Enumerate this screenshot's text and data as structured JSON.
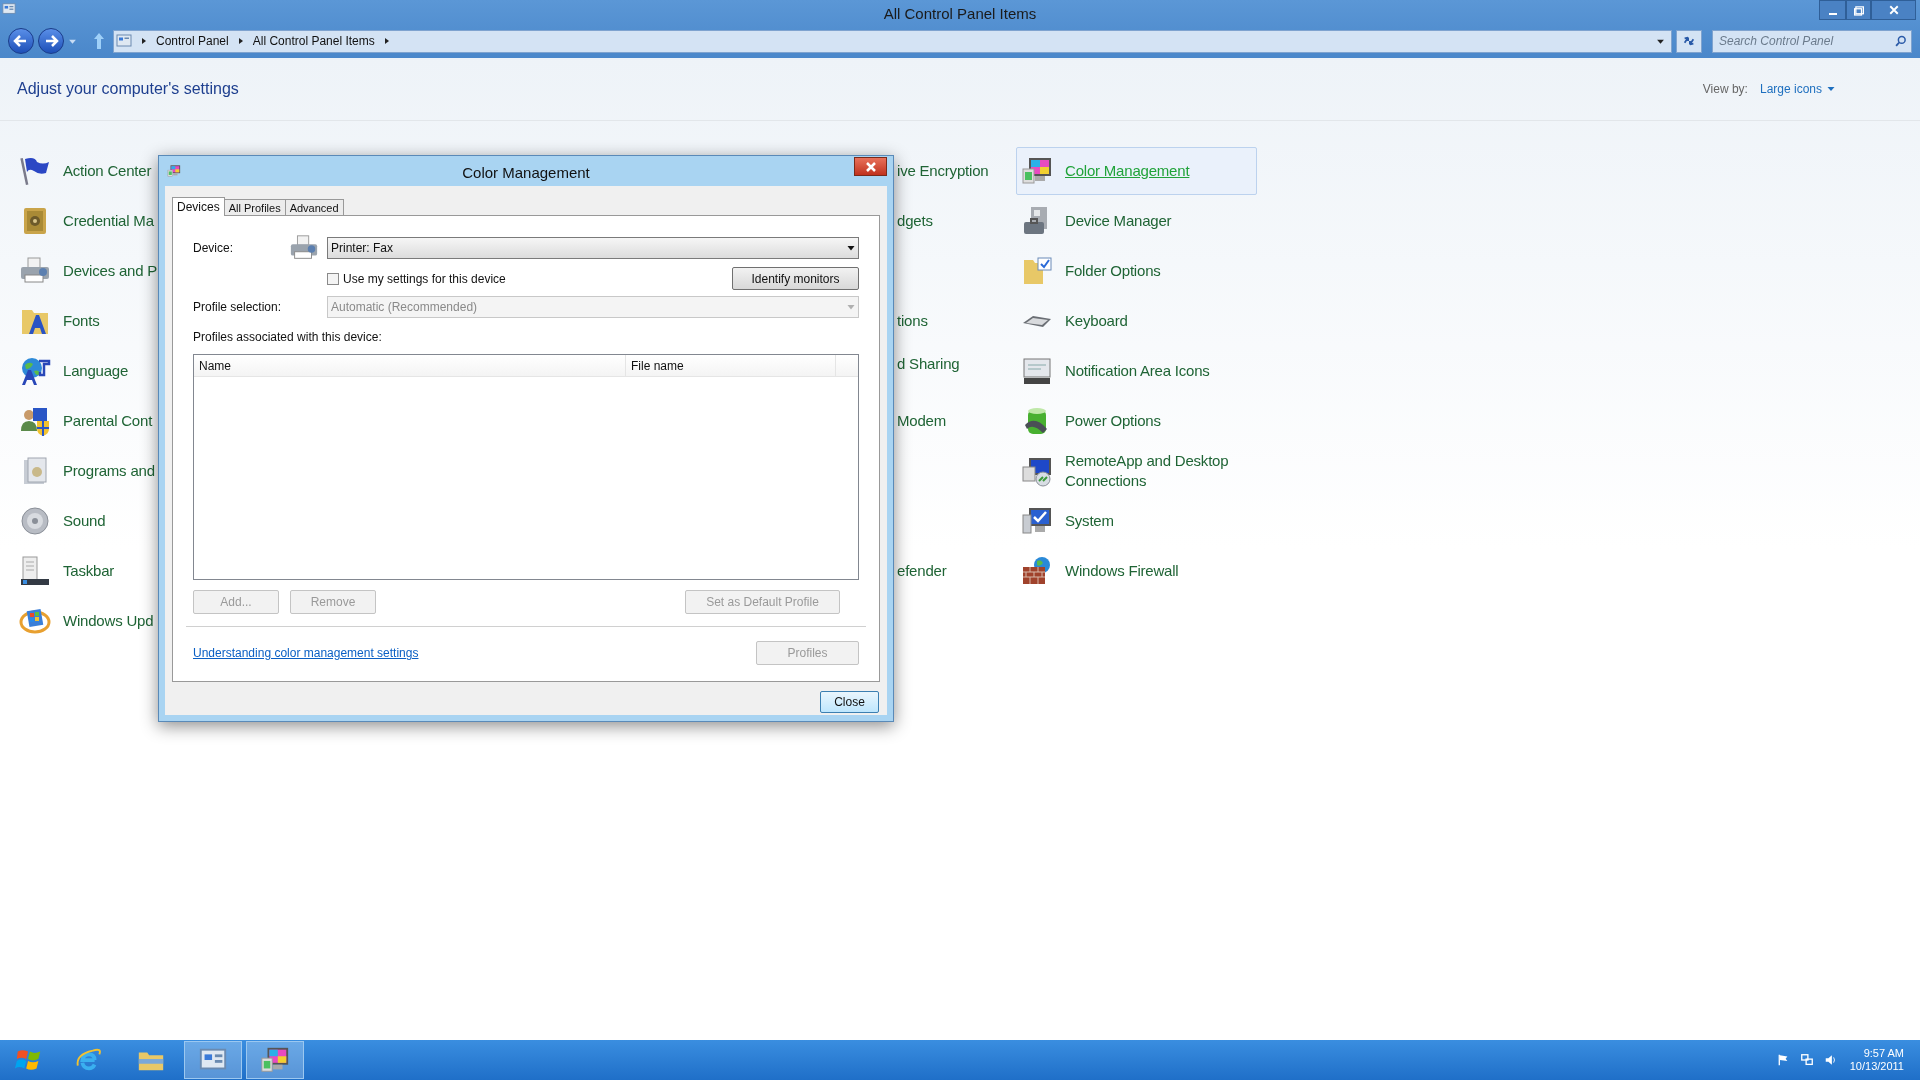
{
  "window": {
    "title": "All Control Panel Items"
  },
  "nav": {
    "breadcrumbs": [
      "Control Panel",
      "All Control Panel Items"
    ],
    "search": {
      "placeholder": "Search Control Panel"
    }
  },
  "header": {
    "heading": "Adjust your computer's settings",
    "view_by_label": "View by:",
    "view_by_value": "Large icons"
  },
  "columns": [
    [
      {
        "label": "Action Center",
        "kind": "flag",
        "selected": false
      },
      {
        "label": "Credential Ma",
        "kind": "safe",
        "selected": false
      },
      {
        "label": "Devices and P",
        "kind": "printer",
        "selected": false
      },
      {
        "label": "Fonts",
        "kind": "fonts",
        "selected": false
      },
      {
        "label": "Language",
        "kind": "globe",
        "selected": false
      },
      {
        "label": "Parental Cont",
        "kind": "people",
        "selected": false
      },
      {
        "label": "Programs and",
        "kind": "box",
        "selected": false
      },
      {
        "label": "Sound",
        "kind": "speaker",
        "selected": false
      },
      {
        "label": "Taskbar",
        "kind": "taskbar",
        "selected": false
      },
      {
        "label": "Windows Upd",
        "kind": "update",
        "selected": false
      }
    ],
    [
      {
        "label": "ive Encryption",
        "kind": "hidden",
        "selected": false
      },
      {
        "label": "dgets",
        "kind": "hidden",
        "selected": false
      },
      {
        "label": "tions",
        "kind": "hidden",
        "selected": false
      },
      {
        "label": "d Sharing",
        "kind": "hidden",
        "selected": false
      },
      {
        "label": "Modem",
        "kind": "hidden",
        "selected": false
      },
      {
        "label": "efender",
        "kind": "hidden",
        "selected": false
      }
    ],
    [
      {
        "label": "Color Management",
        "kind": "color",
        "selected": true
      },
      {
        "label": "Device Manager",
        "kind": "toolbox",
        "selected": false
      },
      {
        "label": "Folder Options",
        "kind": "folder",
        "selected": false
      },
      {
        "label": "Keyboard",
        "kind": "keyboard",
        "selected": false
      },
      {
        "label": "Notification Area Icons",
        "kind": "tray",
        "selected": false
      },
      {
        "label": "Power Options",
        "kind": "battery",
        "selected": false
      },
      {
        "label": "RemoteApp and Desktop Connections",
        "kind": "remote",
        "selected": false
      },
      {
        "label": "System",
        "kind": "system",
        "selected": false
      },
      {
        "label": "Windows Firewall",
        "kind": "firewall",
        "selected": false
      }
    ]
  ],
  "dialog": {
    "title": "Color Management",
    "tabs": [
      {
        "label": "Devices",
        "selected": true
      },
      {
        "label": "All Profiles",
        "selected": false
      },
      {
        "label": "Advanced",
        "selected": false
      }
    ],
    "device_label": "Device:",
    "device_value": "Printer: Fax",
    "use_my_settings": {
      "label": "Use my settings for this device",
      "checked": false
    },
    "identify_button": "Identify monitors",
    "profile_selection_label": "Profile selection:",
    "profile_selection_value": "Automatic (Recommended)",
    "profile_selection_disabled": true,
    "profiles_label": "Profiles associated with this device:",
    "list_columns": [
      "Name",
      "File name"
    ],
    "buttons": [
      {
        "label": "Add...",
        "disabled": true
      },
      {
        "label": "Remove",
        "disabled": true
      },
      {
        "label": "Set as Default Profile",
        "disabled": true
      }
    ],
    "link": "Understanding color management settings",
    "profiles_button": {
      "label": "Profiles",
      "disabled": true
    },
    "close_button": "Close"
  },
  "taskbar": {
    "buttons": [
      {
        "kind": "start",
        "running": false
      },
      {
        "kind": "browser",
        "running": false
      },
      {
        "kind": "explorer",
        "running": false
      },
      {
        "kind": "control",
        "running": true
      },
      {
        "kind": "color",
        "running": true
      }
    ],
    "clock": {
      "time": "9:57 AM",
      "date": "10/13/2011"
    }
  }
}
